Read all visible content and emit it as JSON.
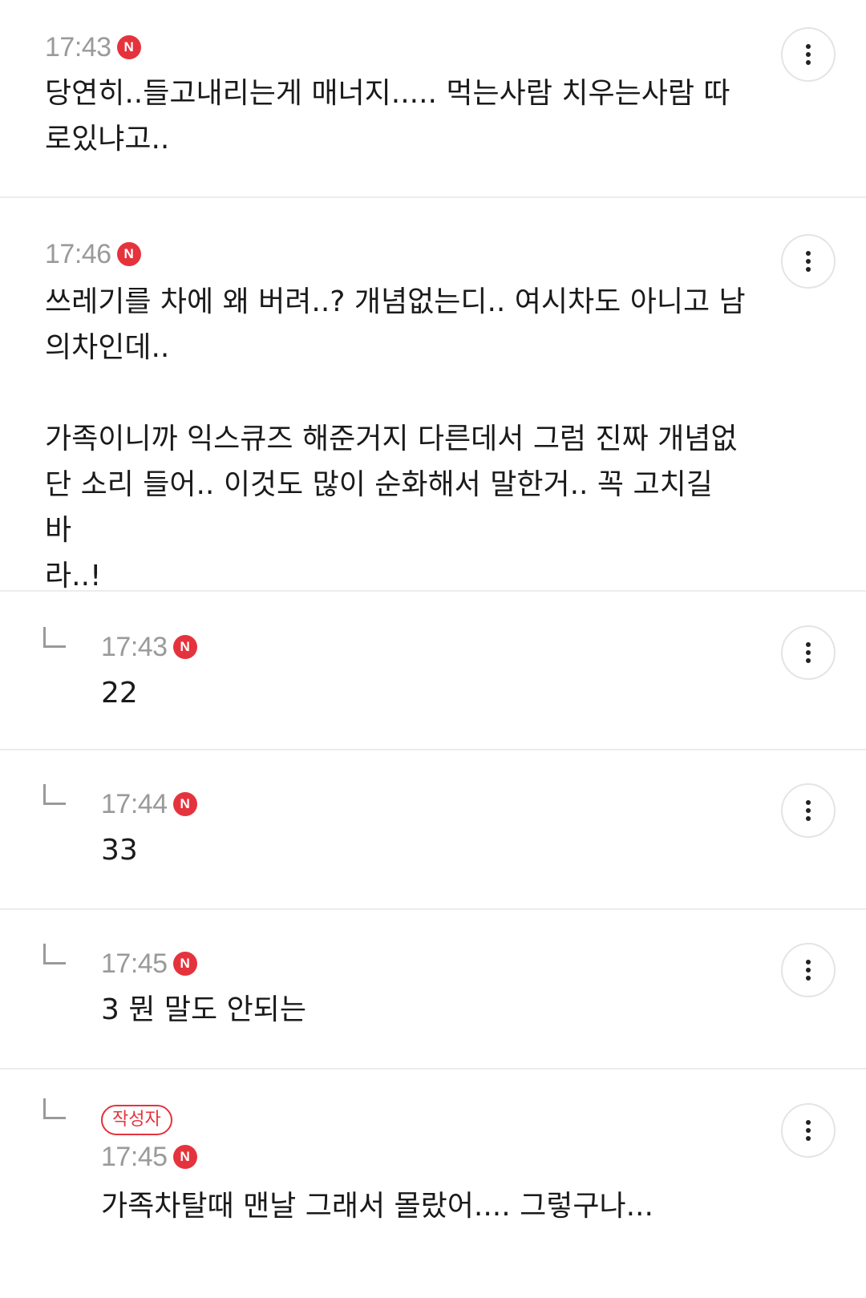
{
  "comments": [
    {
      "time": "17:43",
      "new_badge": "N",
      "text": "당연히..들고내리는게 매너지..... 먹는사람 치우는사람 따\n로있냐고.."
    },
    {
      "time": "17:46",
      "new_badge": "N",
      "text": "쓰레기를 차에 왜 버려..? 개념없는디.. 여시차도 아니고 남\n의차인데..\n\n가족이니까 익스큐즈 해준거지 다른데서 그럼 진짜 개념없\n단 소리 들어.. 이것도 많이 순화해서 말한거.. 꼭 고치길 바\n라..!"
    }
  ],
  "replies": [
    {
      "time": "17:43",
      "new_badge": "N",
      "text": "22"
    },
    {
      "time": "17:44",
      "new_badge": "N",
      "text": "33"
    },
    {
      "time": "17:45",
      "new_badge": "N",
      "text": "3 뭔 말도 안되는"
    },
    {
      "author_badge": "작성자",
      "time": "17:45",
      "new_badge": "N",
      "text": "가족차탈때 맨날 그래서 몰랐어.... 그렇구나..."
    }
  ],
  "colors": {
    "new_badge": "#e5333d",
    "author_badge": "#e5333d",
    "time_text": "#9a9a9a",
    "divider": "#ececec"
  },
  "icons": {
    "more": "more-vertical-icon",
    "reply": "reply-arrow-icon"
  }
}
